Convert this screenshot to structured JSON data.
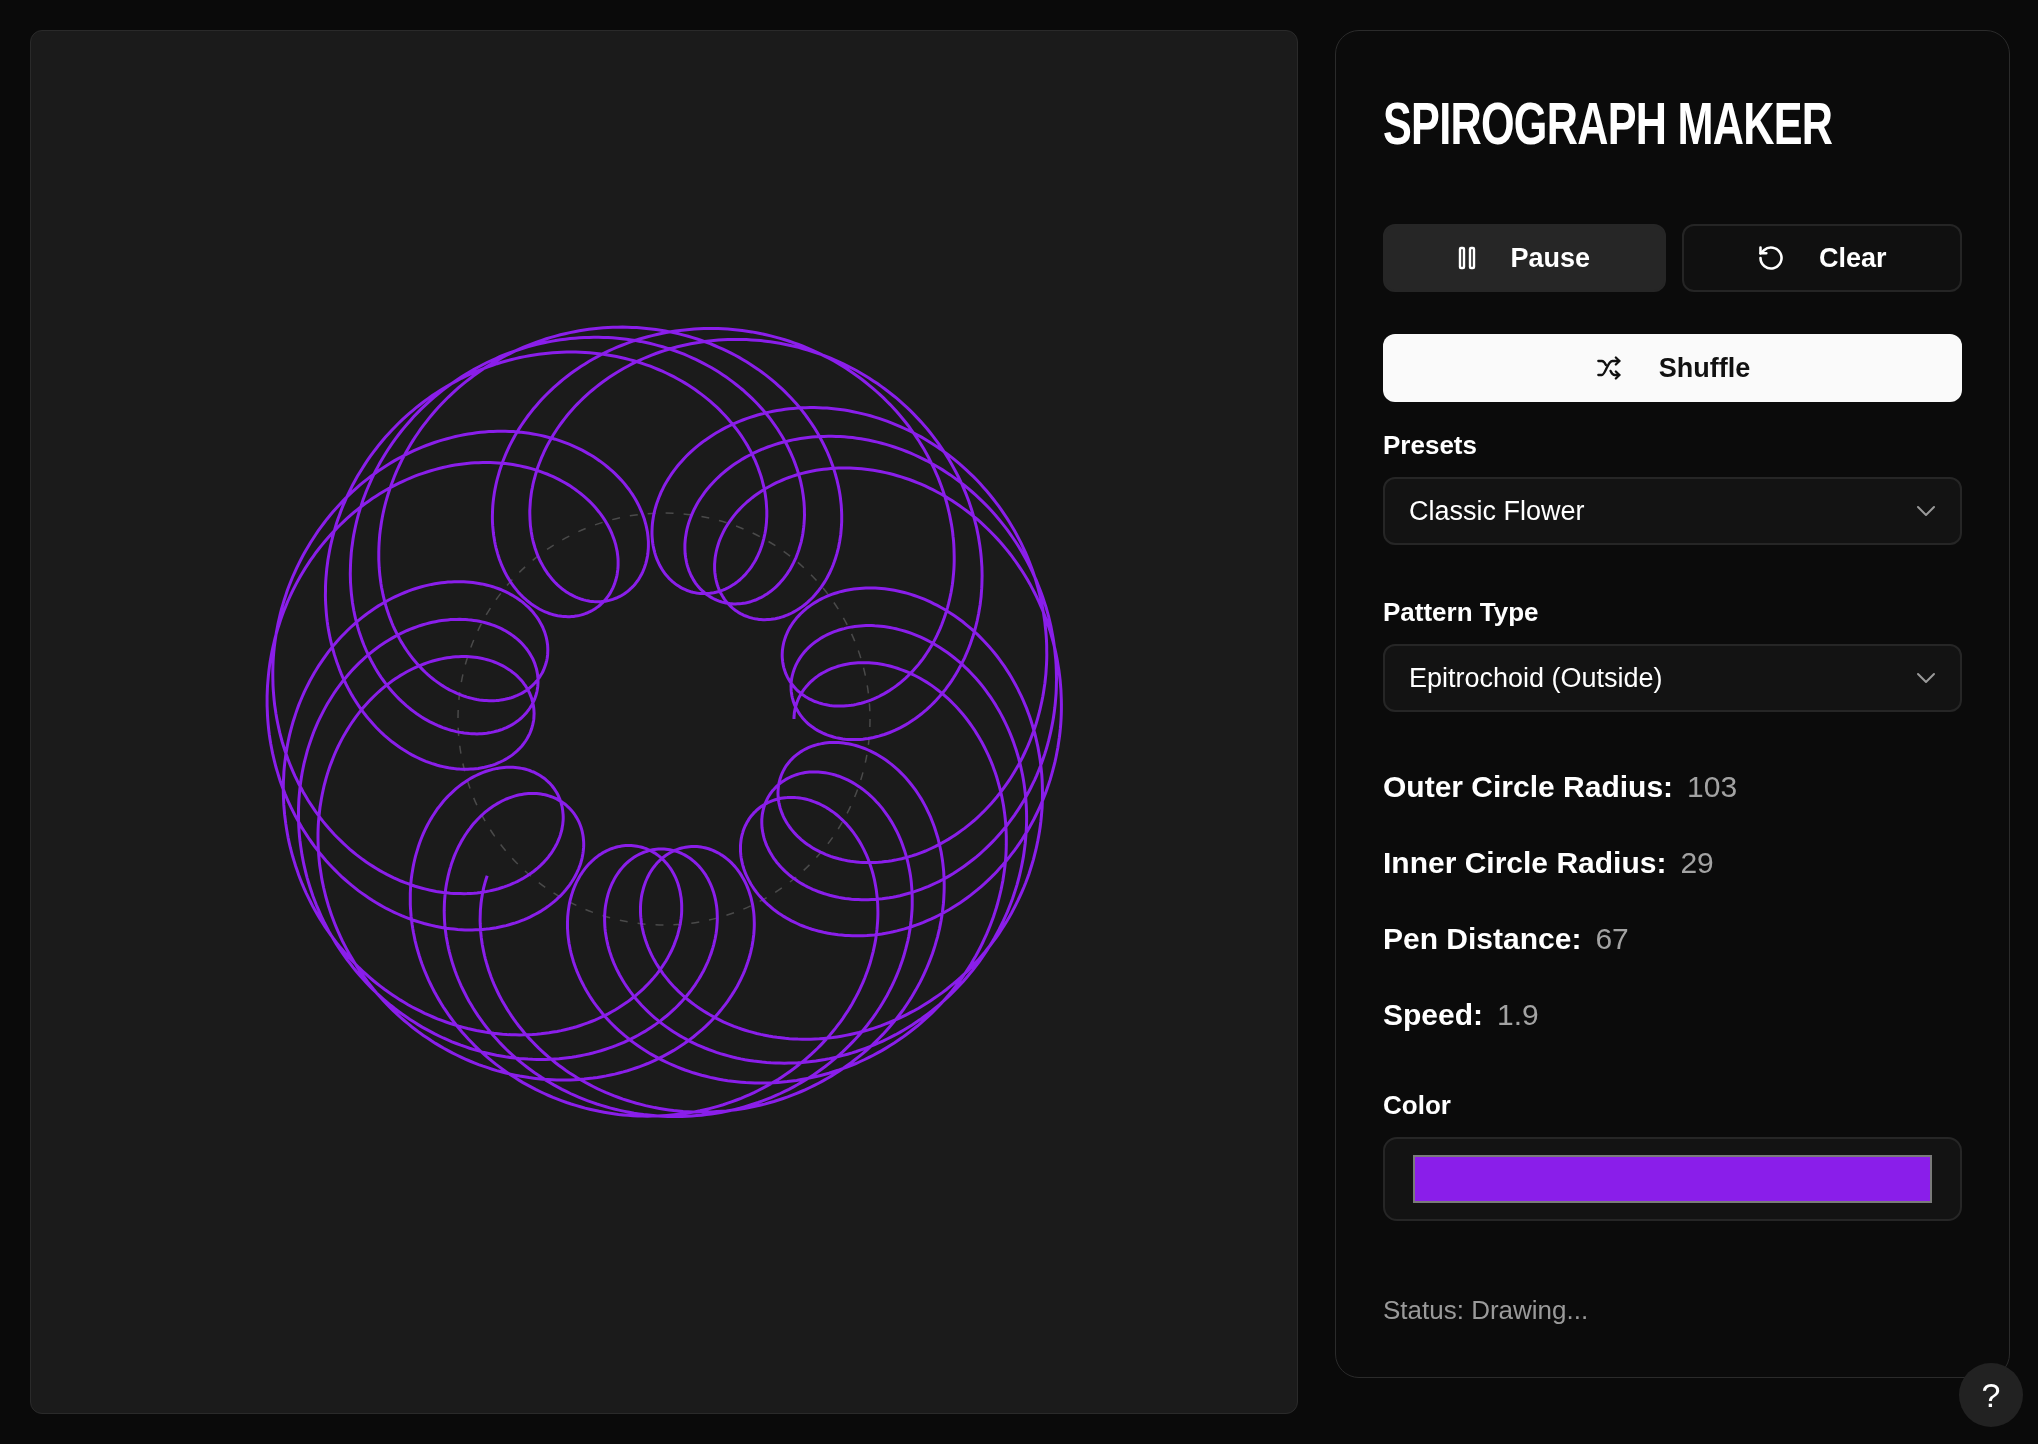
{
  "title": "SPIROGRAPH MAKER",
  "buttons": [
    {
      "kind": "pause",
      "label": "Pause"
    },
    {
      "kind": "clear",
      "label": "Clear"
    }
  ],
  "shuffle": {
    "label": "Shuffle"
  },
  "selects": [
    {
      "label": "Presets",
      "value": "Classic Flower"
    },
    {
      "label": "Pattern Type",
      "value": "Epitrochoid (Outside)"
    }
  ],
  "params": [
    {
      "label": "Outer Circle Radius:",
      "value": "103"
    },
    {
      "label": "Inner Circle Radius:",
      "value": "29"
    },
    {
      "label": "Pen Distance:",
      "value": "67"
    },
    {
      "label": "Speed:",
      "value": "1.9"
    }
  ],
  "color": {
    "label": "Color",
    "color": "#8a1eea"
  },
  "status": "Status: Drawing...",
  "help": "?"
}
